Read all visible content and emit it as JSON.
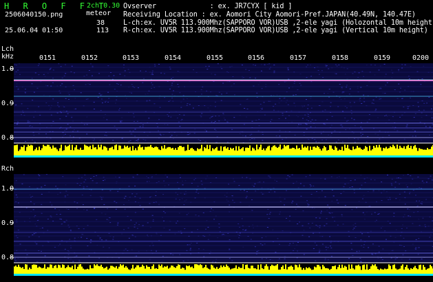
{
  "header": {
    "app_title": "H R O F F T",
    "mode": "2ch 0.30",
    "meteor_label": "meteor",
    "filename": "2506040150.png",
    "lch_count": "38",
    "rch_count": "113",
    "datetime": "25.06.04 01:50",
    "observer": "Ovserver             : ex. JR7CYX [ kid ]",
    "location": "Receiving Location : ex. Aomori City Aomori-Pref.JAPAN(40.49N, 140.47E)",
    "lch_info": "L-ch:ex. UV5R 113.900Mhz(SAPPORO VOR)USB ,2-ele yagi (Holozontal 10m height)",
    "rch_info": "R-ch:ex. UV5R 113.900Mhz(SAPPORO VOR)USB ,2-ele yagi (Vertical 10m height)"
  },
  "lch": {
    "label": "Lch",
    "unit": "kHz",
    "ticks": [
      "1.0",
      "0.9",
      "0.8"
    ]
  },
  "rch": {
    "label": "Rch",
    "ticks": [
      "1.0",
      "0.9",
      "0.8"
    ]
  },
  "time_labels": [
    "0151",
    "0152",
    "0153",
    "0154",
    "0155",
    "0156",
    "0157",
    "0158",
    "0159",
    "0200"
  ],
  "colors": {
    "text_green": "#33ff33",
    "text_white": "#ffffff",
    "panel_bg": "#0a0a3c",
    "level_fill": "#ffff00",
    "level_base": "#00e5ff",
    "signal_line": "#ff6bd6"
  }
}
